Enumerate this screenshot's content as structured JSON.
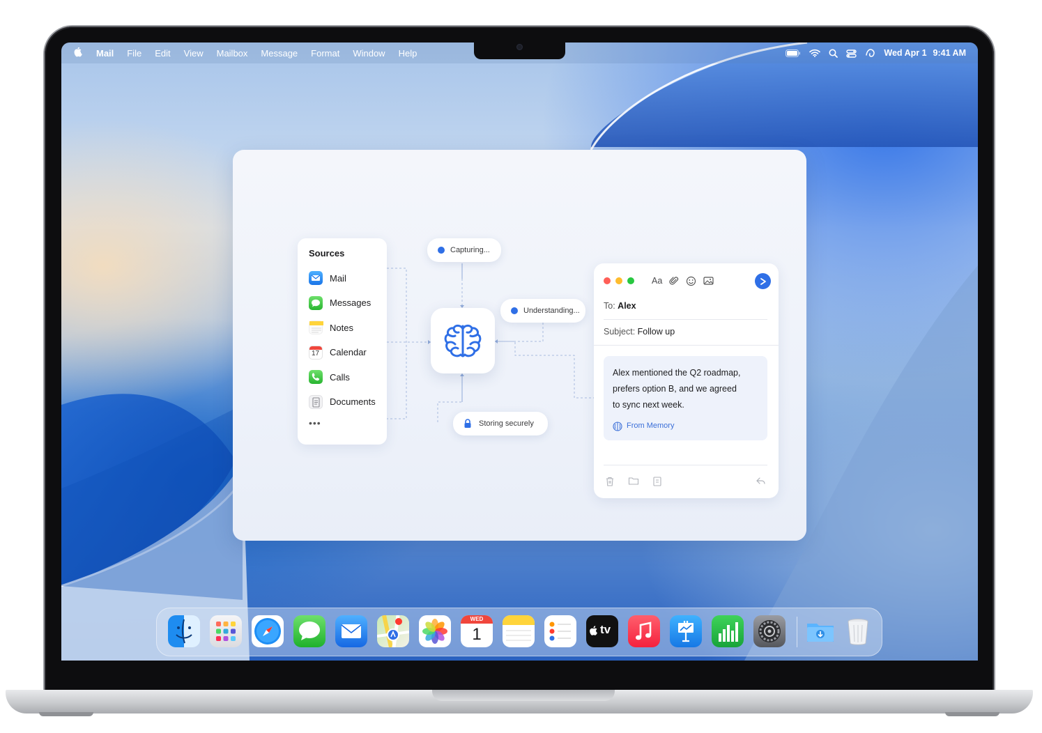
{
  "menubar": {
    "app_name": "Mail",
    "menus": [
      "File",
      "Edit",
      "View",
      "Mailbox",
      "Message",
      "Format",
      "Window",
      "Help"
    ],
    "date": "Wed Apr 1",
    "time": "9:41 AM",
    "status_icons": [
      "battery-icon",
      "wifi-icon",
      "search-icon",
      "control-center-icon",
      "siri-icon"
    ]
  },
  "sources": {
    "title": "Sources",
    "items": [
      {
        "label": "Mail",
        "icon": "mail-icon"
      },
      {
        "label": "Messages",
        "icon": "messages-icon"
      },
      {
        "label": "Notes",
        "icon": "notes-icon"
      },
      {
        "label": "Calendar",
        "icon": "calendar-icon",
        "icon_text": "17"
      },
      {
        "label": "Calls",
        "icon": "phone-icon"
      },
      {
        "label": "Documents",
        "icon": "document-icon"
      }
    ],
    "more": "•••"
  },
  "pipeline": {
    "capturing": "Capturing...",
    "understanding": "Understanding...",
    "storing": "Storing securely"
  },
  "composer": {
    "format_label": "Aa",
    "to_label": "To:",
    "to_value": "Alex",
    "subject_label": "Subject:",
    "subject_value": "Follow up",
    "memory_text_1": "Alex mentioned the Q2 roadmap,",
    "memory_text_2": "prefers option B, and we agreed",
    "memory_text_3": "to sync next week.",
    "from_memory": "From Memory"
  },
  "dock": {
    "apps": [
      "Finder",
      "Launchpad",
      "Safari",
      "Messages",
      "Mail",
      "Maps",
      "Photos",
      "Calendar",
      "Notes",
      "Reminders",
      "TV",
      "Music",
      "Keynote",
      "Numbers",
      "System Settings",
      "Downloads",
      "Trash"
    ],
    "calendar_day": "WED",
    "calendar_date": "1",
    "tv_label": "tv"
  },
  "colors": {
    "accent": "#2f6fe6",
    "traffic_red": "#ff5f57",
    "traffic_yellow": "#febc2e",
    "traffic_green": "#28c840"
  }
}
